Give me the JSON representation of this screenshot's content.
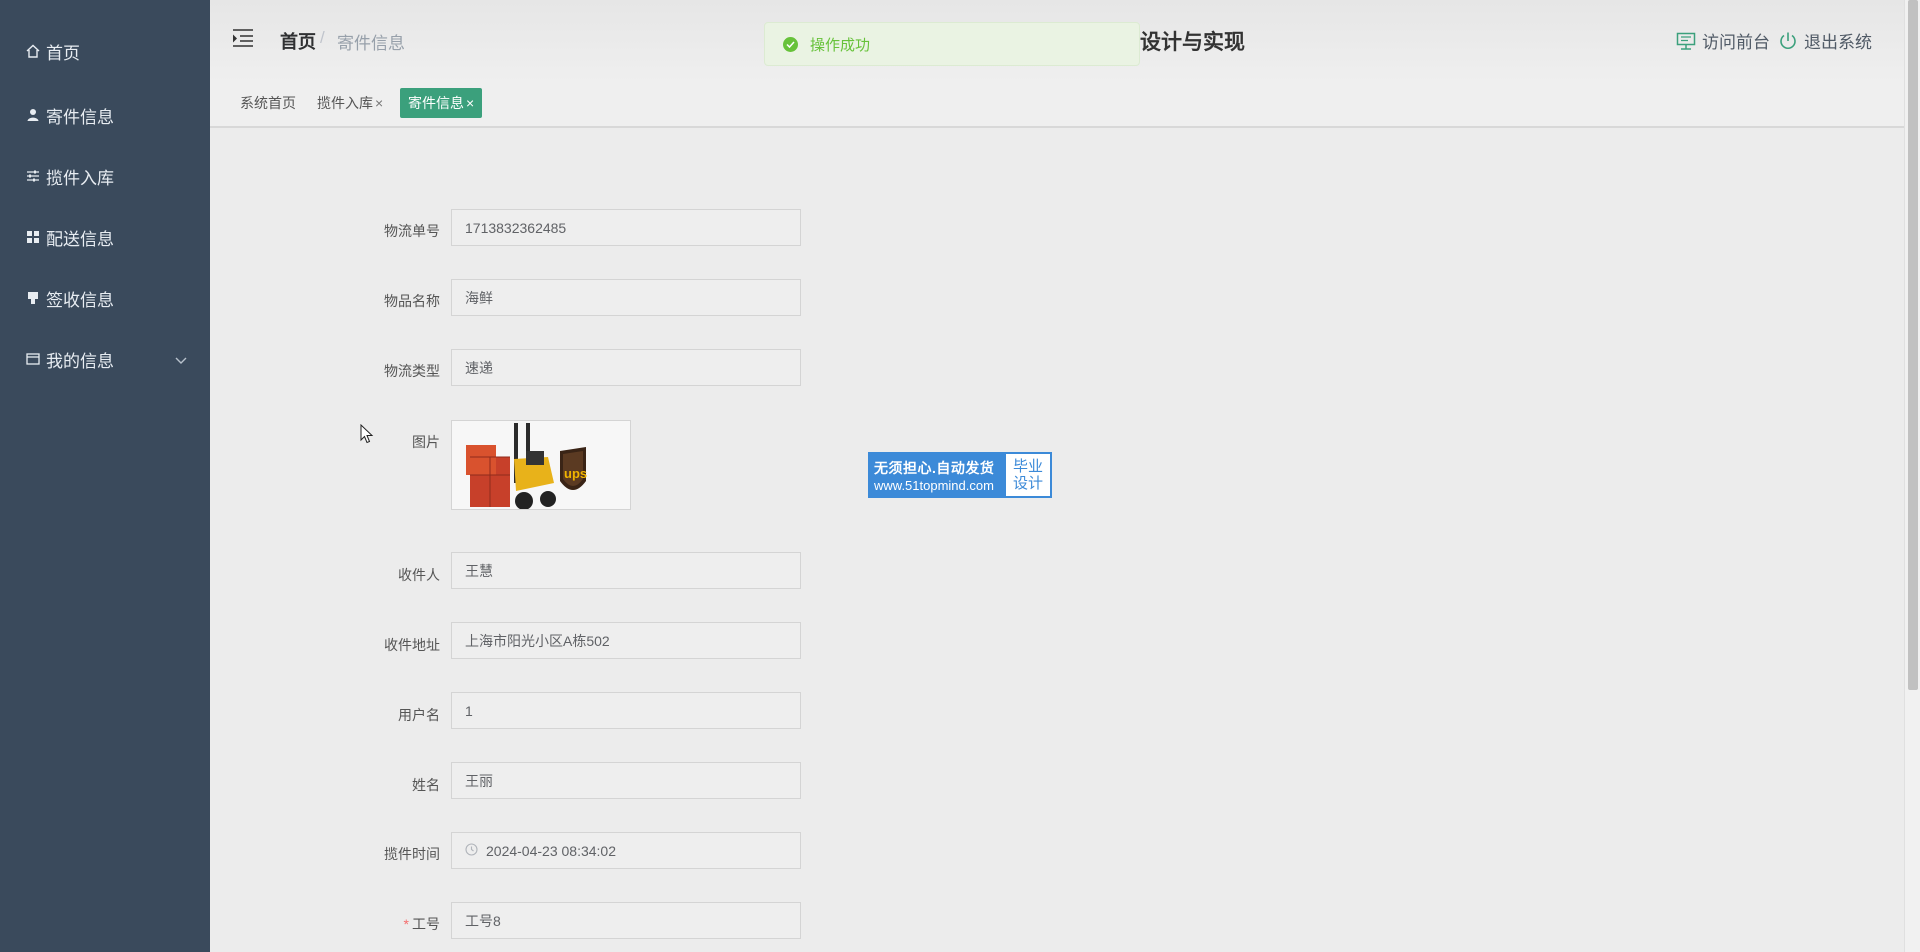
{
  "sidebar": {
    "items": [
      {
        "label": "首页",
        "icon": "home-icon"
      },
      {
        "label": "寄件信息",
        "icon": "user-icon"
      },
      {
        "label": "揽件入库",
        "icon": "sliders-icon"
      },
      {
        "label": "配送信息",
        "icon": "grid-icon"
      },
      {
        "label": "签收信息",
        "icon": "stamp-icon"
      },
      {
        "label": "我的信息",
        "icon": "card-icon"
      }
    ]
  },
  "header": {
    "breadcrumb_home": "首页",
    "breadcrumb_sep": "/",
    "breadcrumb_current": "寄件信息",
    "title": "设计与实现",
    "visit_label": "访问前台",
    "logout_label": "退出系统"
  },
  "toast": {
    "message": "操作成功",
    "color": "#67c23a"
  },
  "tabs": [
    {
      "label": "系统首页"
    },
    {
      "label": "揽件入库",
      "close": "×"
    },
    {
      "label": "寄件信息",
      "close": "×"
    }
  ],
  "form": {
    "fields": [
      {
        "label": "物流单号",
        "value": "1713832362485"
      },
      {
        "label": "物品名称",
        "value": "海鲜"
      },
      {
        "label": "物流类型",
        "value": "速递"
      },
      {
        "label": "图片"
      },
      {
        "label": "收件人",
        "value": "王慧"
      },
      {
        "label": "收件地址",
        "value": "上海市阳光小区A栋502"
      },
      {
        "label": "用户名",
        "value": "1"
      },
      {
        "label": "姓名",
        "value": "王丽"
      },
      {
        "label": "揽件时间",
        "value": "2024-04-23 08:34:02"
      },
      {
        "label": "工号",
        "value": "工号8",
        "required": "*"
      }
    ]
  },
  "watermark": {
    "line1": "无须担心.自动发货",
    "line2": "www.51topmind.com",
    "badge_line1": "毕业",
    "badge_line2": "设计"
  },
  "colors": {
    "sidebar": "#3a4a5c",
    "accent": "#3ba07c",
    "success": "#67c23a"
  }
}
